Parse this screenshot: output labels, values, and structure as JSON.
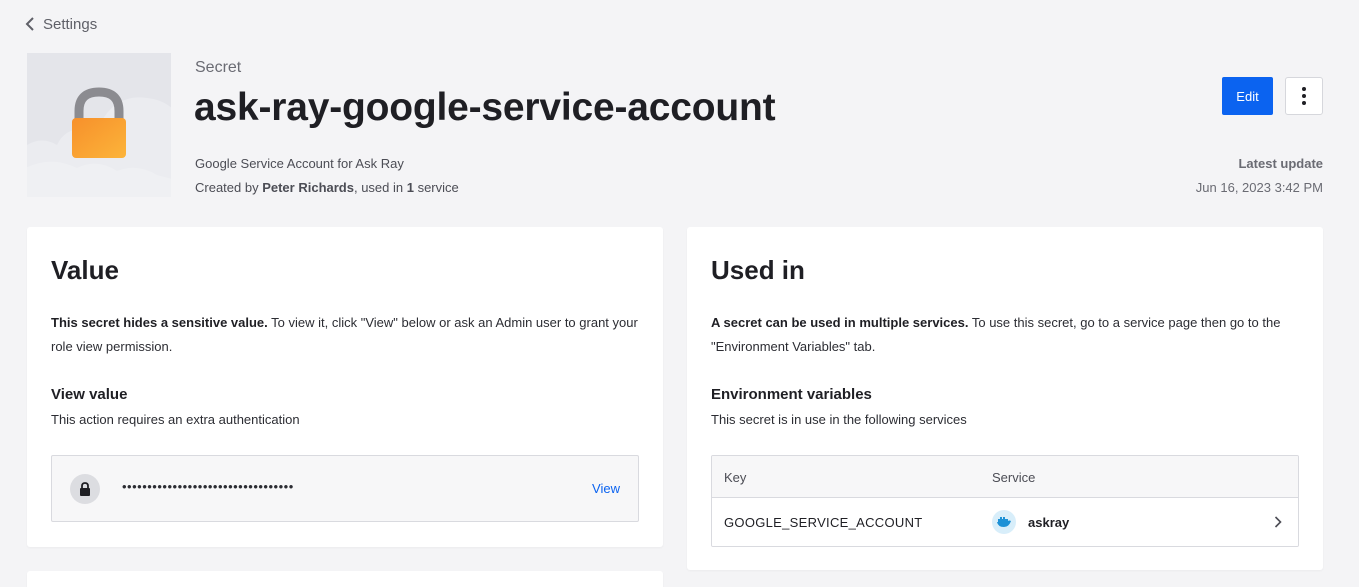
{
  "nav": {
    "back_label": "Settings"
  },
  "header": {
    "eyebrow": "Secret",
    "title": "ask-ray-google-service-account",
    "description": "Google Service Account for Ask Ray",
    "created_prefix": "Created by ",
    "created_by": "Peter Richards",
    "used_in_prefix": ", used in ",
    "used_in_count": "1",
    "used_in_suffix": " service",
    "edit_label": "Edit",
    "latest_update_label": "Latest update",
    "latest_update_value": "Jun 16, 2023 3:42 PM"
  },
  "value_card": {
    "title": "Value",
    "intro_bold": "This secret hides a sensitive value.",
    "intro_text": " To view it, click \"View\" below or ask an Admin user to grant your role view permission.",
    "section_title": "View value",
    "section_sub": "This action requires an extra authentication",
    "masked_value": "••••••••••••••••••••••••••••••••••",
    "view_label": "View"
  },
  "used_in_card": {
    "title": "Used in",
    "intro_bold": "A secret can be used in multiple services.",
    "intro_text": " To use this secret, go to a service page then go to the \"Environment Variables\" tab.",
    "section_title": "Environment variables",
    "section_sub": "This secret is in use in the following services",
    "columns": {
      "key": "Key",
      "service": "Service"
    },
    "rows": [
      {
        "key": "GOOGLE_SERVICE_ACCOUNT",
        "service": "askray"
      }
    ]
  },
  "colors": {
    "accent": "#0b63f0",
    "background": "#f4f4f6",
    "lock_body": "#f9a030",
    "lock_shackle": "#8b8b90"
  },
  "icons": {
    "back": "chevron-left-icon",
    "more": "vertical-ellipsis-icon",
    "lock": "lock-icon",
    "service": "docker-whale-icon",
    "row": "chevron-right-icon"
  }
}
